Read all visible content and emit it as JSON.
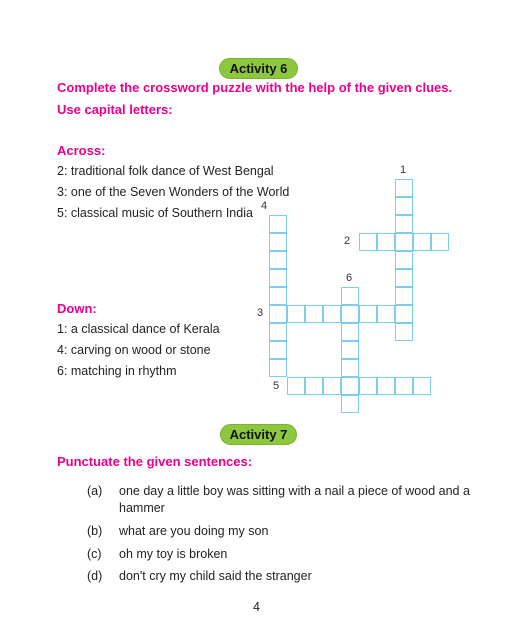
{
  "activity6": {
    "badge": "Activity 6",
    "instruction_line1": "Complete the crossword puzzle with the help of the given clues.",
    "instruction_line2": "Use capital letters:",
    "across_heading": "Across:",
    "across": [
      "2: traditional folk dance of West Bengal",
      "3: one of the Seven Wonders of the World",
      "5: classical music of Southern India"
    ],
    "down_heading": "Down:",
    "down": [
      "1: a classical dance of Kerala",
      "4: carving on wood or stone",
      "6: matching in rhythm"
    ],
    "crossword": {
      "clue_numbers": [
        "1",
        "2",
        "3",
        "4",
        "5",
        "6"
      ],
      "entries": [
        {
          "number": "1",
          "direction": "down",
          "length": 9
        },
        {
          "number": "2",
          "direction": "across",
          "length": 5
        },
        {
          "number": "3",
          "direction": "across",
          "length": 8
        },
        {
          "number": "4",
          "direction": "down",
          "length": 9
        },
        {
          "number": "5",
          "direction": "across",
          "length": 8
        },
        {
          "number": "6",
          "direction": "down",
          "length": 7
        }
      ]
    }
  },
  "activity7": {
    "badge": "Activity 7",
    "instruction": "Punctuate the given sentences:",
    "items": [
      {
        "label": "(a)",
        "line1": "one day a little boy was sitting with a nail a piece of wood and a",
        "line2": "hammer"
      },
      {
        "label": "(b)",
        "line1": "what are you doing my son"
      },
      {
        "label": "(c)",
        "line1": "oh my toy is broken"
      },
      {
        "label": "(d)",
        "line1": "don't cry my child said the stranger"
      }
    ]
  },
  "page_number": "4",
  "colors": {
    "accent_pink": "#ec008c",
    "badge_green": "#8dc63f",
    "grid_blue": "#7fcdee"
  }
}
